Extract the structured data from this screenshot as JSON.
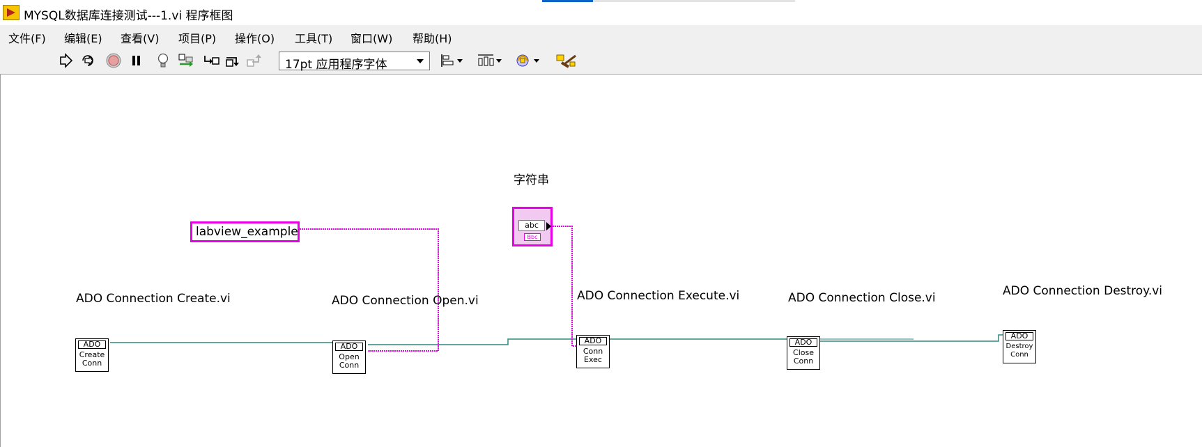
{
  "window": {
    "title": "MYSQL数据库连接测试---1.vi 程序框图"
  },
  "menu": {
    "items": [
      "文件(F)",
      "编辑(E)",
      "查看(V)",
      "项目(P)",
      "操作(O)",
      "工具(T)",
      "窗口(W)",
      "帮助(H)"
    ]
  },
  "toolbar": {
    "font_select_value": "17pt 应用程序字体",
    "icons": [
      "run-arrow-icon",
      "run-continuously-icon",
      "abort-icon",
      "pause-icon",
      "highlight-execution-icon",
      "retain-wire-values-icon",
      "step-into-icon",
      "step-over-icon",
      "step-out-icon",
      "align-objects-icon",
      "distribute-objects-icon",
      "reorder-icon",
      "clean-up-diagram-icon"
    ]
  },
  "diagram": {
    "string_constant": "labview_example",
    "string_control": {
      "label": "字符串",
      "inner_text": "abc",
      "type_text": "Bbc"
    },
    "vis": [
      {
        "label": "ADO Connection Create.vi",
        "header": "ADO",
        "line1": "Create",
        "line2": "Conn"
      },
      {
        "label": "ADO Connection Open.vi",
        "header": "ADO",
        "line1": "Open",
        "line2": "Conn"
      },
      {
        "label": "ADO Connection Execute.vi",
        "header": "ADO",
        "line1": "Conn",
        "line2": "Exec"
      },
      {
        "label": "ADO Connection Close.vi",
        "header": "ADO",
        "line1": "Close",
        "line2": "Conn"
      },
      {
        "label": "ADO Connection Destroy.vi",
        "header": "ADO",
        "line1": "Destroy",
        "line2": "Conn"
      }
    ],
    "colors": {
      "string_wire": "#e600e6",
      "refnum_wire": "#2f8a7e",
      "app_logo": "#f7c400"
    }
  }
}
